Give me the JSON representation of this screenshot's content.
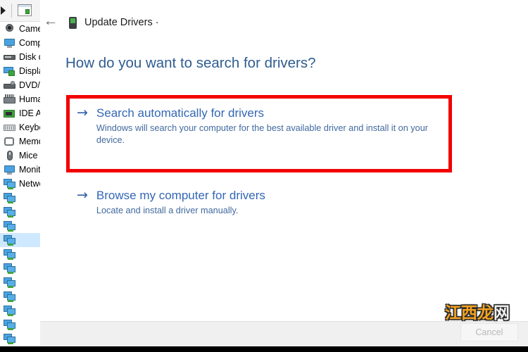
{
  "device_manager": {
    "toolbar": {
      "back_icon": "back-triangle-icon",
      "properties_icon": "properties-window-icon"
    },
    "tree_items": [
      {
        "label": "Cameras",
        "icon": "camera-icon",
        "glyph": "gi-camera",
        "selected": false
      },
      {
        "label": "Computer",
        "icon": "computer-icon",
        "glyph": "gi-monitor",
        "selected": false
      },
      {
        "label": "Disk drives",
        "icon": "disk-drive-icon",
        "glyph": "gi-disk",
        "selected": false
      },
      {
        "label": "Display adapters",
        "icon": "display-adapter-icon",
        "glyph": "gi-display",
        "selected": false
      },
      {
        "label": "DVD/CD-ROM drives",
        "icon": "dvd-drive-icon",
        "glyph": "gi-dvd",
        "selected": false
      },
      {
        "label": "Human Interface Devices",
        "icon": "usb-hub-icon",
        "glyph": "gi-hub",
        "selected": false
      },
      {
        "label": "IDE ATA/ATAPI controllers",
        "icon": "ide-controller-icon",
        "glyph": "gi-ide",
        "selected": false
      },
      {
        "label": "Keyboards",
        "icon": "keyboard-icon",
        "glyph": "gi-keyboard",
        "selected": false
      },
      {
        "label": "Memory technology devices",
        "icon": "memory-device-icon",
        "glyph": "gi-memory",
        "selected": false
      },
      {
        "label": "Mice and other pointing devices",
        "icon": "mouse-icon",
        "glyph": "gi-mouse",
        "selected": false
      },
      {
        "label": "Monitors",
        "icon": "monitor-icon",
        "glyph": "gi-monitor",
        "selected": false
      },
      {
        "label": "Network adapters",
        "icon": "network-adapter-icon",
        "glyph": "gi-network",
        "selected": false
      },
      {
        "label": "",
        "icon": "network-adapter-icon",
        "glyph": "gi-network",
        "selected": false
      },
      {
        "label": "",
        "icon": "network-adapter-icon",
        "glyph": "gi-network",
        "selected": false
      },
      {
        "label": "",
        "icon": "network-adapter-icon",
        "glyph": "gi-network",
        "selected": false
      },
      {
        "label": "",
        "icon": "network-adapter-icon",
        "glyph": "gi-network",
        "selected": true
      },
      {
        "label": "",
        "icon": "network-adapter-icon",
        "glyph": "gi-network",
        "selected": false
      },
      {
        "label": "",
        "icon": "network-adapter-icon",
        "glyph": "gi-network",
        "selected": false
      },
      {
        "label": "",
        "icon": "network-adapter-icon",
        "glyph": "gi-network",
        "selected": false
      },
      {
        "label": "",
        "icon": "network-adapter-icon",
        "glyph": "gi-network",
        "selected": false
      },
      {
        "label": "",
        "icon": "network-adapter-icon",
        "glyph": "gi-network",
        "selected": false
      },
      {
        "label": "",
        "icon": "network-adapter-icon",
        "glyph": "gi-network",
        "selected": false
      },
      {
        "label": "",
        "icon": "network-adapter-icon",
        "glyph": "gi-network",
        "selected": false
      }
    ]
  },
  "dialog": {
    "back_arrow": "←",
    "device_icon": "network-adapter-icon",
    "title": "Update Drivers ·",
    "heading": "How do you want to search for drivers?",
    "options": [
      {
        "arrow": "→",
        "title": "Search automatically for drivers",
        "description": "Windows will search your computer for the best available driver and install it on your device.",
        "highlighted": true
      },
      {
        "arrow": "→",
        "title": "Browse my computer for drivers",
        "description": "Locate and install a driver manually.",
        "highlighted": false
      }
    ],
    "footer": {
      "cancel_label": "Cancel"
    }
  },
  "annotation": {
    "highlight_color": "#f20000",
    "shape": "rectangle"
  },
  "watermark": {
    "part1": "江西",
    "part2": "龙",
    "part3": "网"
  },
  "colors": {
    "link_blue": "#3367b5",
    "heading_blue": "#2f5c91",
    "desc_blue": "#41699f",
    "highlight_red": "#f20000",
    "footer_gray": "#f0f0f0",
    "selection_blue": "#cde8ff"
  }
}
